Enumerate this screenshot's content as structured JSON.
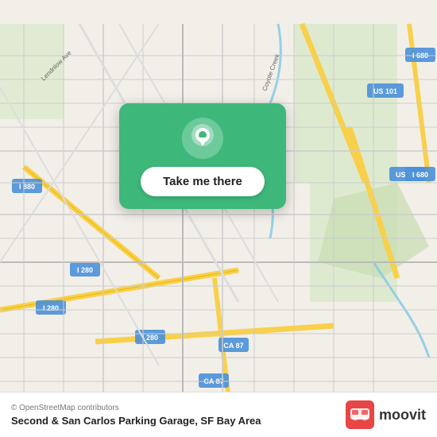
{
  "map": {
    "attribution": "© OpenStreetMap contributors",
    "region": "SF Bay Area",
    "bg_color": "#f2efe9"
  },
  "card": {
    "button_label": "Take me there"
  },
  "bottom_bar": {
    "copyright": "© OpenStreetMap contributors",
    "location_name": "Second & San Carlos Parking Garage, SF Bay Area"
  },
  "moovit": {
    "text": "moovit"
  }
}
